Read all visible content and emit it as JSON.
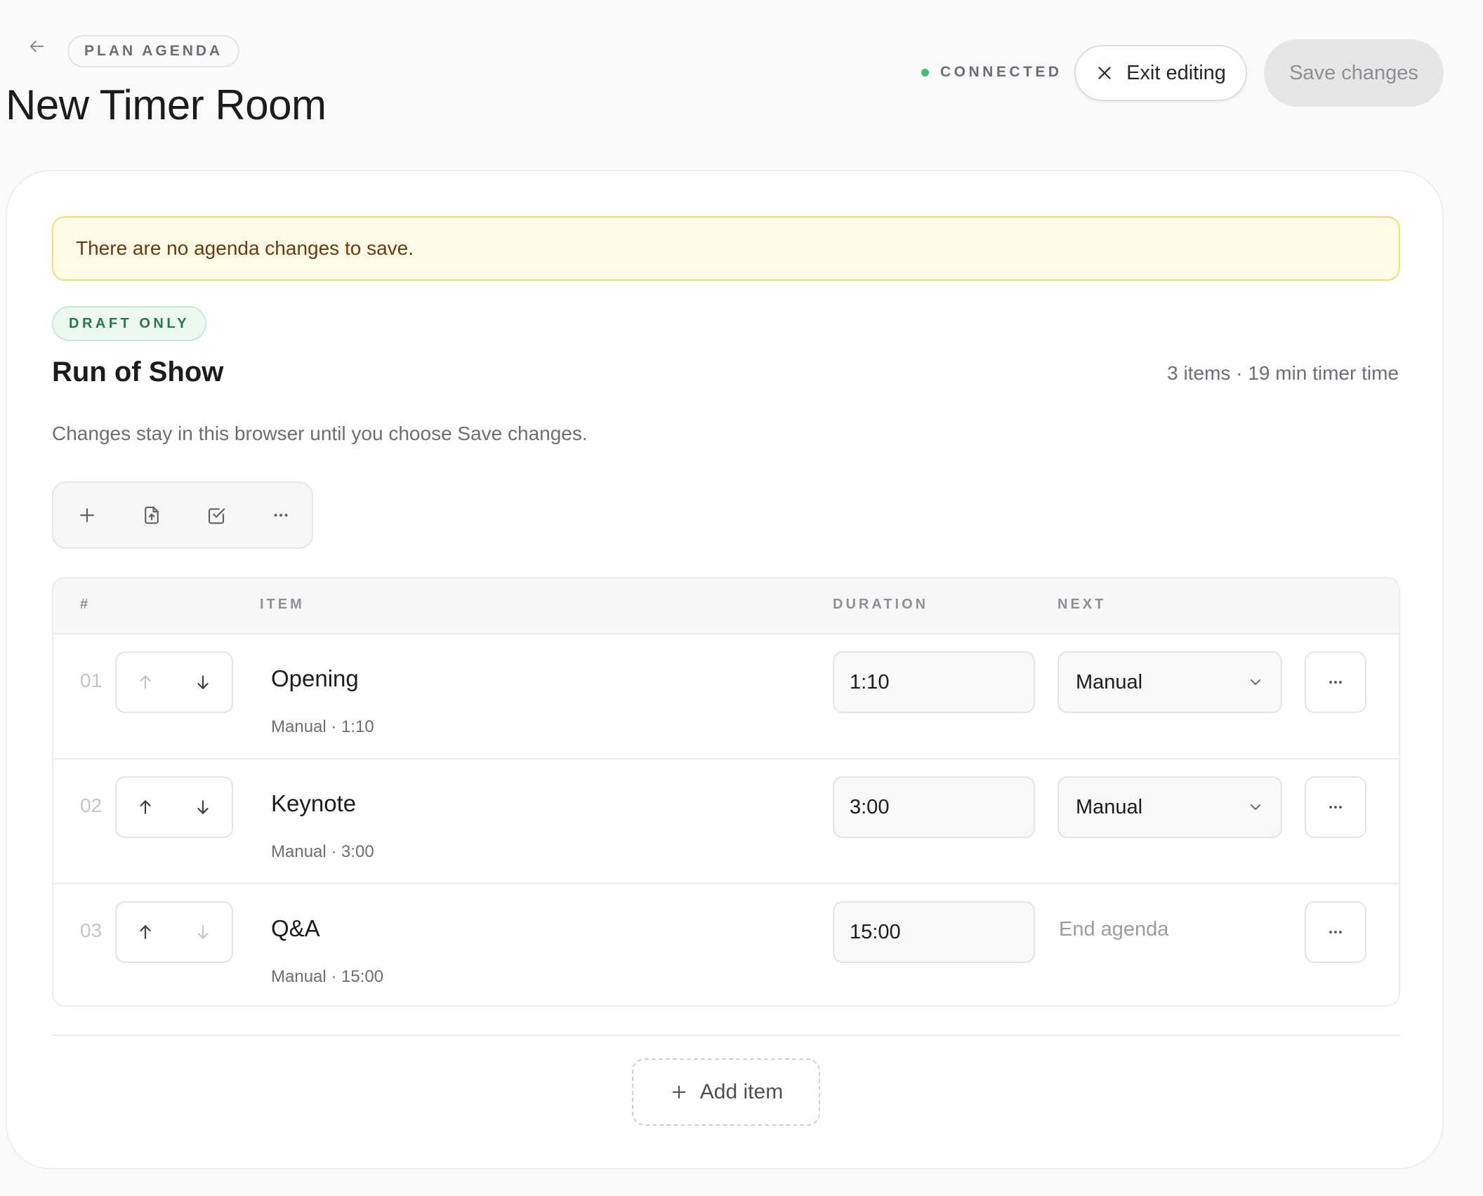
{
  "header": {
    "eyebrow": "PLAN AGENDA",
    "title": "New Timer Room",
    "status_label": "CONNECTED",
    "status_color": "#3fbf74",
    "exit_label": "Exit editing",
    "save_label": "Save changes"
  },
  "notice": {
    "text": "There are no agenda changes to save."
  },
  "section": {
    "badge": "DRAFT ONLY",
    "title": "Run of Show",
    "summary": "3 items · 19 min timer time",
    "helper": "Changes stay in this browser until you choose Save changes."
  },
  "toolbar": {
    "icons": [
      "plus-icon",
      "file-upload-icon",
      "checkbox-icon",
      "more-horizontal-icon"
    ]
  },
  "table": {
    "columns": {
      "num": "#",
      "item": "ITEM",
      "duration": "DURATION",
      "next": "NEXT"
    },
    "rows": [
      {
        "num": "01",
        "name": "Opening",
        "meta": "Manual · 1:10",
        "duration": "1:10",
        "next": "Manual",
        "next_is_select": true,
        "can_move_up": false,
        "can_move_down": true
      },
      {
        "num": "02",
        "name": "Keynote",
        "meta": "Manual · 3:00",
        "duration": "3:00",
        "next": "Manual",
        "next_is_select": true,
        "can_move_up": true,
        "can_move_down": true
      },
      {
        "num": "03",
        "name": "Q&A",
        "meta": "Manual · 15:00",
        "duration": "15:00",
        "next": "End agenda",
        "next_is_select": false,
        "can_move_up": true,
        "can_move_down": false
      }
    ]
  },
  "add_item": {
    "label": "Add item"
  }
}
